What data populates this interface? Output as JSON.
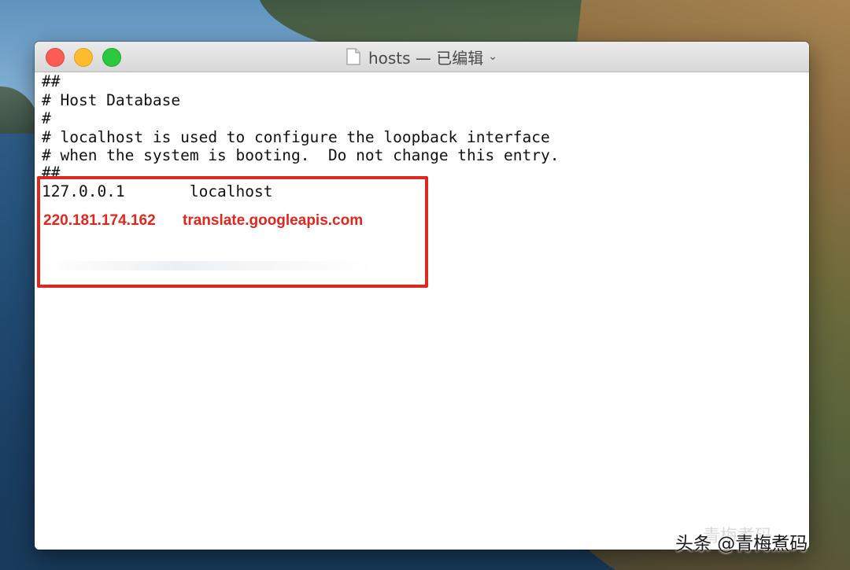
{
  "window": {
    "title": "hosts — 已编辑",
    "chevron": "⌄"
  },
  "editor": {
    "lines": [
      "##",
      "# Host Database",
      "#",
      "# localhost is used to configure the loopback interface",
      "# when the system is booting.  Do not change this entry.",
      "##",
      "127.0.0.1       localhost"
    ],
    "added_entry": {
      "ip": "220.181.174.162",
      "hostname": "translate.googleapis.com"
    }
  },
  "watermark": {
    "text": "头条 @青梅煮码",
    "ghost_text": "青梅煮码"
  },
  "colors": {
    "highlight": "#e0271d",
    "close": "#fd5c54",
    "minimize": "#fdbc2e",
    "zoom": "#2bc840"
  },
  "icons": {
    "title": "document-icon",
    "traffic": [
      "close-icon",
      "minimize-icon",
      "zoom-icon"
    ]
  }
}
